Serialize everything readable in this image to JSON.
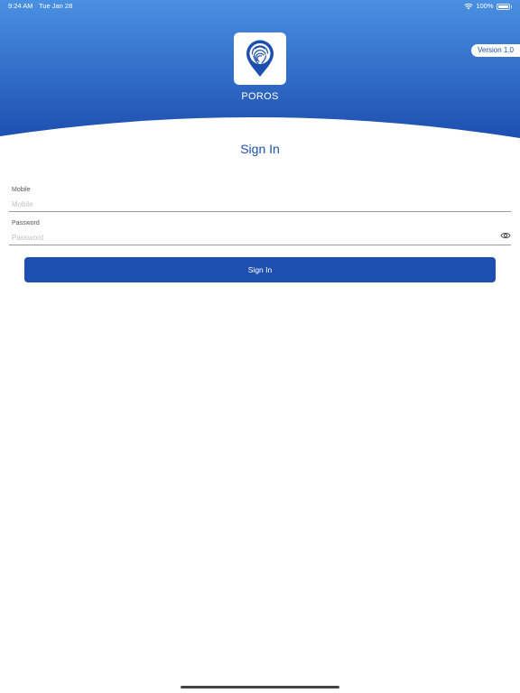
{
  "status_bar": {
    "time": "9:24 AM",
    "date": "Tue Jan 28",
    "battery": "100%"
  },
  "header": {
    "app_name": "POROS",
    "version": "Version 1.0",
    "logo_icon": "fingerprint-location-pin-icon",
    "gradient_top": "#4a90e2",
    "gradient_bottom": "#1d4fb0"
  },
  "signin": {
    "title": "Sign In",
    "mobile_label": "Mobile",
    "mobile_placeholder": "Mobile",
    "mobile_value": "",
    "password_label": "Password",
    "password_placeholder": "Password",
    "password_value": "",
    "show_password_icon": "eye-icon",
    "button_label": "Sign In"
  },
  "colors": {
    "accent": "#1d4fb0"
  }
}
